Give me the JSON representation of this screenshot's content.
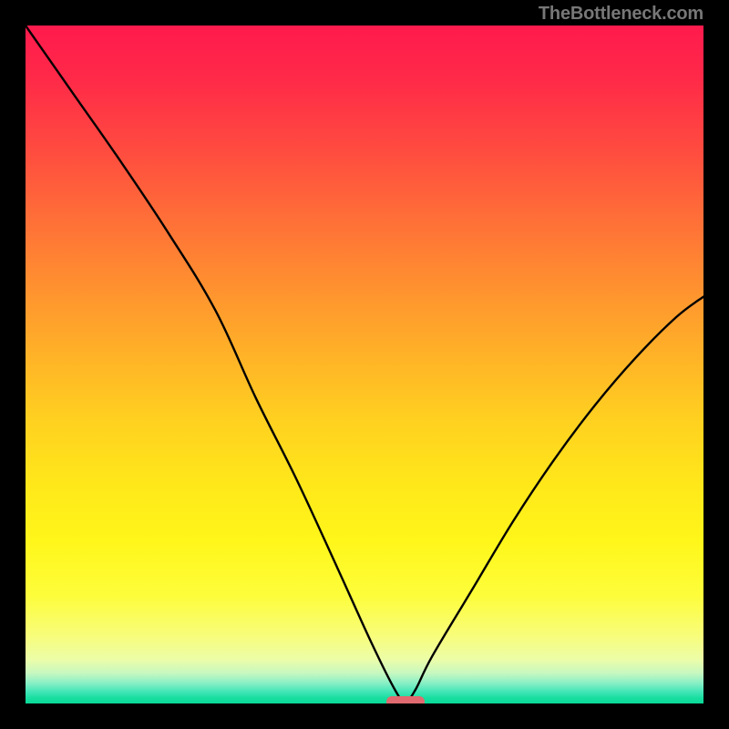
{
  "attribution": "TheBottleneck.com",
  "colors": {
    "background": "#000000",
    "marker": "#e06a6f",
    "curve": "#000000",
    "gradient_top": "#ff1a4d",
    "gradient_bottom": "#08d998"
  },
  "chart_data": {
    "type": "line",
    "title": "",
    "xlabel": "",
    "ylabel": "",
    "xlim": [
      0,
      100
    ],
    "ylim": [
      0,
      100
    ],
    "series": [
      {
        "name": "bottleneck-curve",
        "x": [
          0,
          7,
          14,
          21,
          28,
          34,
          40,
          46,
          51,
          54.5,
          56,
          57.5,
          60,
          66,
          72,
          78,
          84,
          90,
          96,
          100
        ],
        "values": [
          100,
          90,
          80,
          69.5,
          58,
          45,
          33,
          20,
          9,
          2,
          0.3,
          2,
          7,
          17,
          27,
          36,
          44,
          51,
          57,
          60
        ]
      }
    ],
    "annotations": [
      {
        "name": "min-marker",
        "x": 56,
        "y": 0.3
      }
    ],
    "grid": false,
    "legend": false
  }
}
